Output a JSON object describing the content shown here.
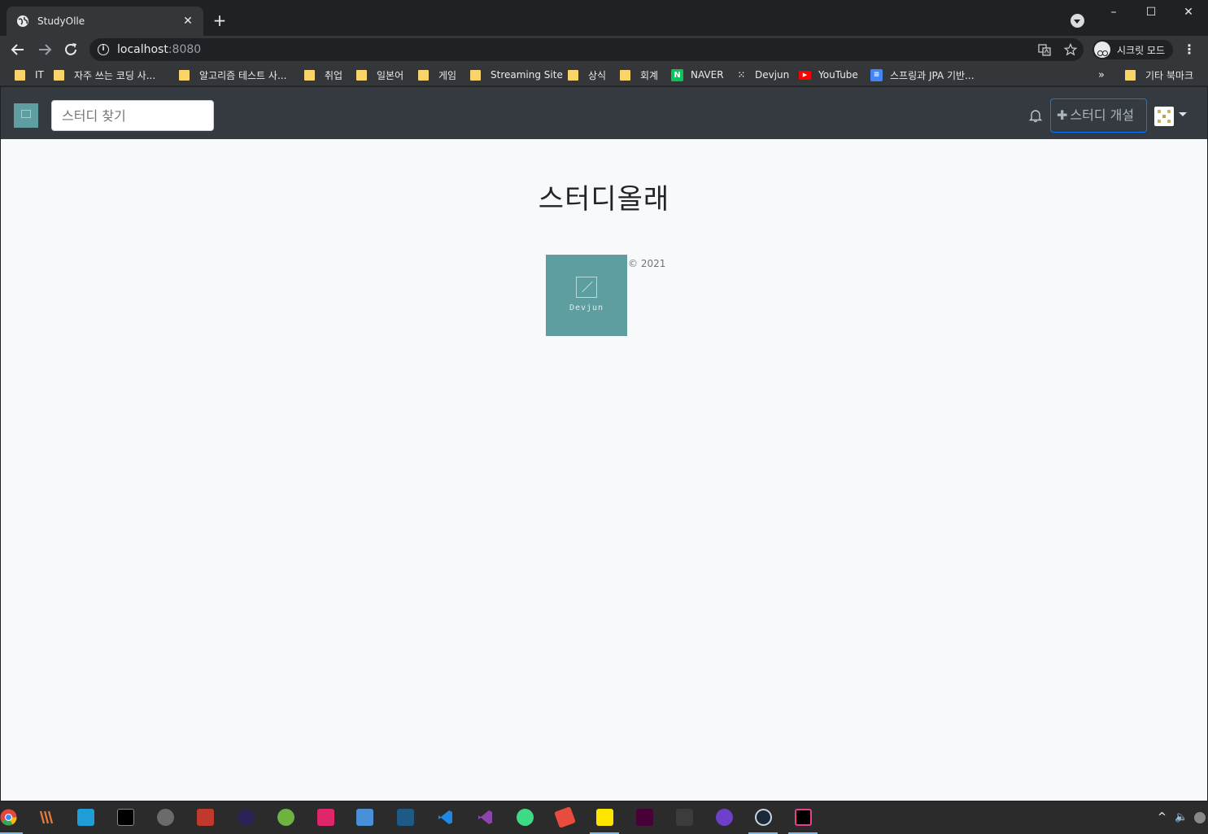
{
  "browser": {
    "tab_title": "StudyOlle",
    "tab_close": "✕",
    "new_tab": "+",
    "window_controls": {
      "minimize": "–",
      "maximize": "☐",
      "close": "✕"
    },
    "url_host": "localhost",
    "url_port": ":8080",
    "incognito_label": "시크릿 모드",
    "icons": [
      "back-arrow-icon",
      "forward-arrow-icon",
      "reload-icon",
      "info-icon",
      "translate-icon",
      "star-icon",
      "incognito-icon",
      "kebab-menu-icon"
    ]
  },
  "bookmarks": {
    "items": [
      {
        "label": "IT",
        "type": "folder"
      },
      {
        "label": "자주 쓰는 코딩 사...",
        "type": "folder"
      },
      {
        "label": "알고리즘 테스트 사...",
        "type": "folder"
      },
      {
        "label": "취업",
        "type": "folder"
      },
      {
        "label": "일본어",
        "type": "folder"
      },
      {
        "label": "게임",
        "type": "folder"
      },
      {
        "label": "Streaming Site",
        "type": "folder"
      },
      {
        "label": "상식",
        "type": "folder"
      },
      {
        "label": "회계",
        "type": "folder"
      },
      {
        "label": "NAVER",
        "type": "site",
        "icon": "naver-icon",
        "color": "#03c75a"
      },
      {
        "label": "Devjun",
        "type": "site",
        "icon": "devjun-icon",
        "color": "#35363a"
      },
      {
        "label": "YouTube",
        "type": "site",
        "icon": "youtube-icon",
        "color": "#ff0000"
      },
      {
        "label": "스프링과 JPA 기반...",
        "type": "site",
        "icon": "docs-icon",
        "color": "#4285f4"
      }
    ],
    "overflow": "»",
    "other_bookmarks": "기타 북마크"
  },
  "app": {
    "search_placeholder": "스터디 찾기",
    "create_study_plus": "✚",
    "create_study_label": "스터디 개설",
    "headline": "스터디올래",
    "logo_text": "Devjun",
    "copyright": "© 2021",
    "brand_color": "#5f9ea0",
    "navbar_color": "#343a40",
    "accent_color": "#007bff"
  },
  "taskbar": {
    "apps": [
      {
        "name": "chrome",
        "color": "#e8453c"
      },
      {
        "name": "winamp",
        "color": "#2b2b2b"
      },
      {
        "name": "pycharm",
        "color": "#1f9dd8"
      },
      {
        "name": "terminal",
        "color": "#000000"
      },
      {
        "name": "gimp",
        "color": "#6b6b6b"
      },
      {
        "name": "notepad",
        "color": "#c0392b"
      },
      {
        "name": "eclipse",
        "color": "#2c2255"
      },
      {
        "name": "spring-tool",
        "color": "#6db33f"
      },
      {
        "name": "cube-app",
        "color": "#e0266b"
      },
      {
        "name": "media-app",
        "color": "#4a90d9"
      },
      {
        "name": "mysql-workbench",
        "color": "#1d5b86"
      },
      {
        "name": "vscode",
        "color": "#1e88e5"
      },
      {
        "name": "visual-studio",
        "color": "#8e44ad"
      },
      {
        "name": "android-studio",
        "color": "#3ddc84"
      },
      {
        "name": "fontforge",
        "color": "#e74c3c"
      },
      {
        "name": "kakaotalk",
        "color": "#fee500"
      },
      {
        "name": "adobe-xd",
        "color": "#470137"
      },
      {
        "name": "cmd",
        "color": "#3c3c3c"
      },
      {
        "name": "github-desktop",
        "color": "#6e40c9"
      },
      {
        "name": "steam",
        "color": "#1b2838"
      },
      {
        "name": "intellij",
        "color": "#000000"
      }
    ],
    "tray": {
      "chevron": "^",
      "volume": "🔈"
    }
  }
}
